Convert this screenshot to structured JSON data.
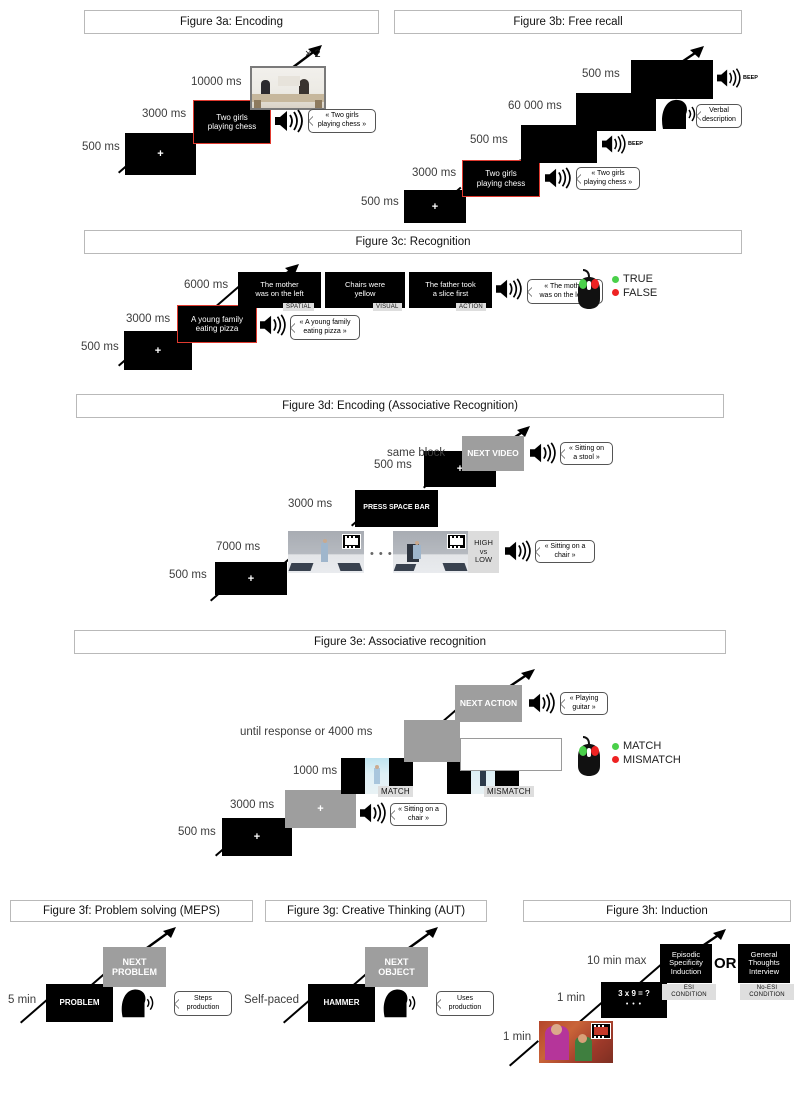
{
  "figure": {
    "panels": [
      {
        "id": "3a",
        "title": "Figure 3a: Encoding",
        "durations": [
          "500 ms",
          "3000 ms",
          "10000 ms"
        ],
        "screens": [
          "+",
          "Two girls\nplaying chess",
          "video"
        ],
        "speech_bubbles": [
          "« Two girls\nplaying chess »"
        ],
        "repeat_label": "× 2"
      },
      {
        "id": "3b",
        "title": "Figure 3b: Free recall",
        "durations": [
          "500 ms",
          "3000 ms",
          "500 ms",
          "60 000 ms",
          "500 ms"
        ],
        "screens": [
          "+",
          "Two girls\nplaying chess",
          "",
          "",
          ""
        ],
        "speech_bubbles": [
          "« Two girls\nplaying chess »",
          "Verbal\ndescription"
        ],
        "beep_labels": [
          "BEEP",
          "BEEP"
        ]
      },
      {
        "id": "3c",
        "title": "Figure 3c: Recognition",
        "durations": [
          "500 ms",
          "3000 ms",
          "6000 ms"
        ],
        "screens": [
          "+",
          "A young family\neating pizza",
          "The mother\nwas on the left",
          "Chairs were\nyellow",
          "The father took\na slice first"
        ],
        "tags": [
          "SPATIAL",
          "VISUAL",
          "ACTION"
        ],
        "speech_bubbles": [
          "« A young family\neating pizza »",
          "« The mother\nwas on the left »"
        ],
        "response_legend": [
          {
            "label": "TRUE",
            "color": "#4ad04a"
          },
          {
            "label": "FALSE",
            "color": "#ee2222"
          }
        ]
      },
      {
        "id": "3d",
        "title": "Figure 3d: Encoding (Associative Recognition)",
        "durations": [
          "500 ms",
          "7000 ms",
          "3000 ms",
          "500 ms",
          "same block"
        ],
        "screens": [
          "+",
          "video-start",
          "PRESS SPACE BAR",
          "+",
          "NEXT VIDEO"
        ],
        "rating_label": "HIGH\nvs\nLOW",
        "ellipsis": "• • •",
        "speech_bubbles": [
          "« Sitting on a\nchair »",
          "« Sitting on\na stool »"
        ]
      },
      {
        "id": "3e",
        "title": "Figure 3e: Associative recognition",
        "durations": [
          "500 ms",
          "3000 ms",
          "1000 ms",
          "until response or 4000 ms",
          ""
        ],
        "screens": [
          "+",
          "+",
          "match-pair",
          "",
          "NEXT ACTION"
        ],
        "tags": [
          "MATCH",
          "MISMATCH"
        ],
        "speech_bubbles": [
          "« Sitting on a\nchair »",
          "« Playing\nguitar »"
        ],
        "response_legend": [
          {
            "label": "MATCH",
            "color": "#4ad04a"
          },
          {
            "label": "MISMATCH",
            "color": "#ee2222"
          }
        ]
      },
      {
        "id": "3f",
        "title": "Figure 3f: Problem solving (MEPS)",
        "durations": [
          "5 min"
        ],
        "screens": [
          "PROBLEM",
          "NEXT\nPROBLEM"
        ],
        "speech_bubbles": [
          "Steps\nproduction"
        ]
      },
      {
        "id": "3g",
        "title": "Figure 3g: Creative Thinking (AUT)",
        "durations": [
          "Self-paced"
        ],
        "screens": [
          "HAMMER",
          "NEXT\nOBJECT"
        ],
        "speech_bubbles": [
          "Uses\nproduction"
        ]
      },
      {
        "id": "3h",
        "title": "Figure 3h: Induction",
        "durations": [
          "1 min",
          "1 min",
          "10 min max"
        ],
        "screens": [
          "photo",
          "3 x 9 = ?",
          "Episodic\nSpecificity\nInduction",
          "General\nThoughts\nInterview"
        ],
        "math_ellipsis": "• • •",
        "tags": [
          "ESI\nCONDITION",
          "No-ESI\nCONDITION"
        ],
        "or_label": "OR"
      }
    ]
  },
  "a": {
    "title": "Figure 3a: Encoding",
    "d1": "500 ms",
    "d2": "3000 ms",
    "d3": "10000 ms",
    "s_fix": "+",
    "s_txt": "Two girls\nplaying chess",
    "bubble": "« Two girls\nplaying chess »",
    "repeat": "× 2"
  },
  "b": {
    "title": "Figure 3b: Free recall",
    "d1": "500 ms",
    "d2": "3000 ms",
    "d3": "500 ms",
    "d4": "60 000 ms",
    "d5": "500 ms",
    "s_fix": "+",
    "s_txt": "Two girls\nplaying chess",
    "bubble1": "« Two girls\nplaying chess »",
    "bubble2": "Verbal\ndescription",
    "beep1": "BEEP",
    "beep2": "BEEP"
  },
  "c": {
    "title": "Figure 3c: Recognition",
    "d1": "500 ms",
    "d2": "3000 ms",
    "d3": "6000 ms",
    "s_fix": "+",
    "s_cue": "A young family\neating pizza",
    "s1": "The mother\nwas on the left",
    "s2": "Chairs were\nyellow",
    "s3": "The father took\na slice first",
    "t1": "SPATIAL",
    "t2": "VISUAL",
    "t3": "ACTION",
    "bubble1": "« A young family\neating pizza »",
    "bubble2": "« The mother\nwas on the left »",
    "leg1": "TRUE",
    "leg2": "FALSE",
    "col1": "#4ad04a",
    "col2": "#ee2222"
  },
  "d": {
    "title": "Figure 3d: Encoding (Associative Recognition)",
    "d1": "500 ms",
    "d2": "7000 ms",
    "d3": "3000 ms",
    "d4": "500 ms",
    "d5": "same block",
    "s_fix": "+",
    "s_space": "PRESS SPACE BAR",
    "s_fix2": "+",
    "s_next": "NEXT VIDEO",
    "rating": "HIGH\nvs\nLOW",
    "ell": "• • •",
    "bubble1": "« Sitting on a\nchair »",
    "bubble2": "« Sitting on\na stool »"
  },
  "e": {
    "title": "Figure 3e: Associative recognition",
    "d1": "500 ms",
    "d2": "3000 ms",
    "d3": "1000 ms",
    "d4": "until response or 4000 ms",
    "s_fix": "+",
    "s_fix2": "+",
    "s_next": "NEXT ACTION",
    "t1": "MATCH",
    "t2": "MISMATCH",
    "bubble1": "« Sitting on a\nchair »",
    "bubble2": "« Playing\nguitar »",
    "leg1": "MATCH",
    "leg2": "MISMATCH",
    "col1": "#4ad04a",
    "col2": "#ee2222"
  },
  "f": {
    "title": "Figure 3f: Problem solving (MEPS)",
    "d1": "5 min",
    "s_prob": "PROBLEM",
    "s_next": "NEXT\nPROBLEM",
    "bubble": "Steps\nproduction"
  },
  "g": {
    "title": "Figure 3g: Creative Thinking (AUT)",
    "d1": "Self-paced",
    "s_obj": "HAMMER",
    "s_next": "NEXT\nOBJECT",
    "bubble": "Uses\nproduction"
  },
  "h": {
    "title": "Figure 3h: Induction",
    "d1": "1 min",
    "d2": "1 min",
    "d3": "10 min max",
    "s_math": "3 x 9 = ?",
    "math_ell": "• • •",
    "s_esi": "Episodic\nSpecificity\nInduction",
    "s_noesi": "General\nThoughts\nInterview",
    "t1": "ESI\nCONDITION",
    "t2": "No-ESI\nCONDITION",
    "or": "OR"
  }
}
